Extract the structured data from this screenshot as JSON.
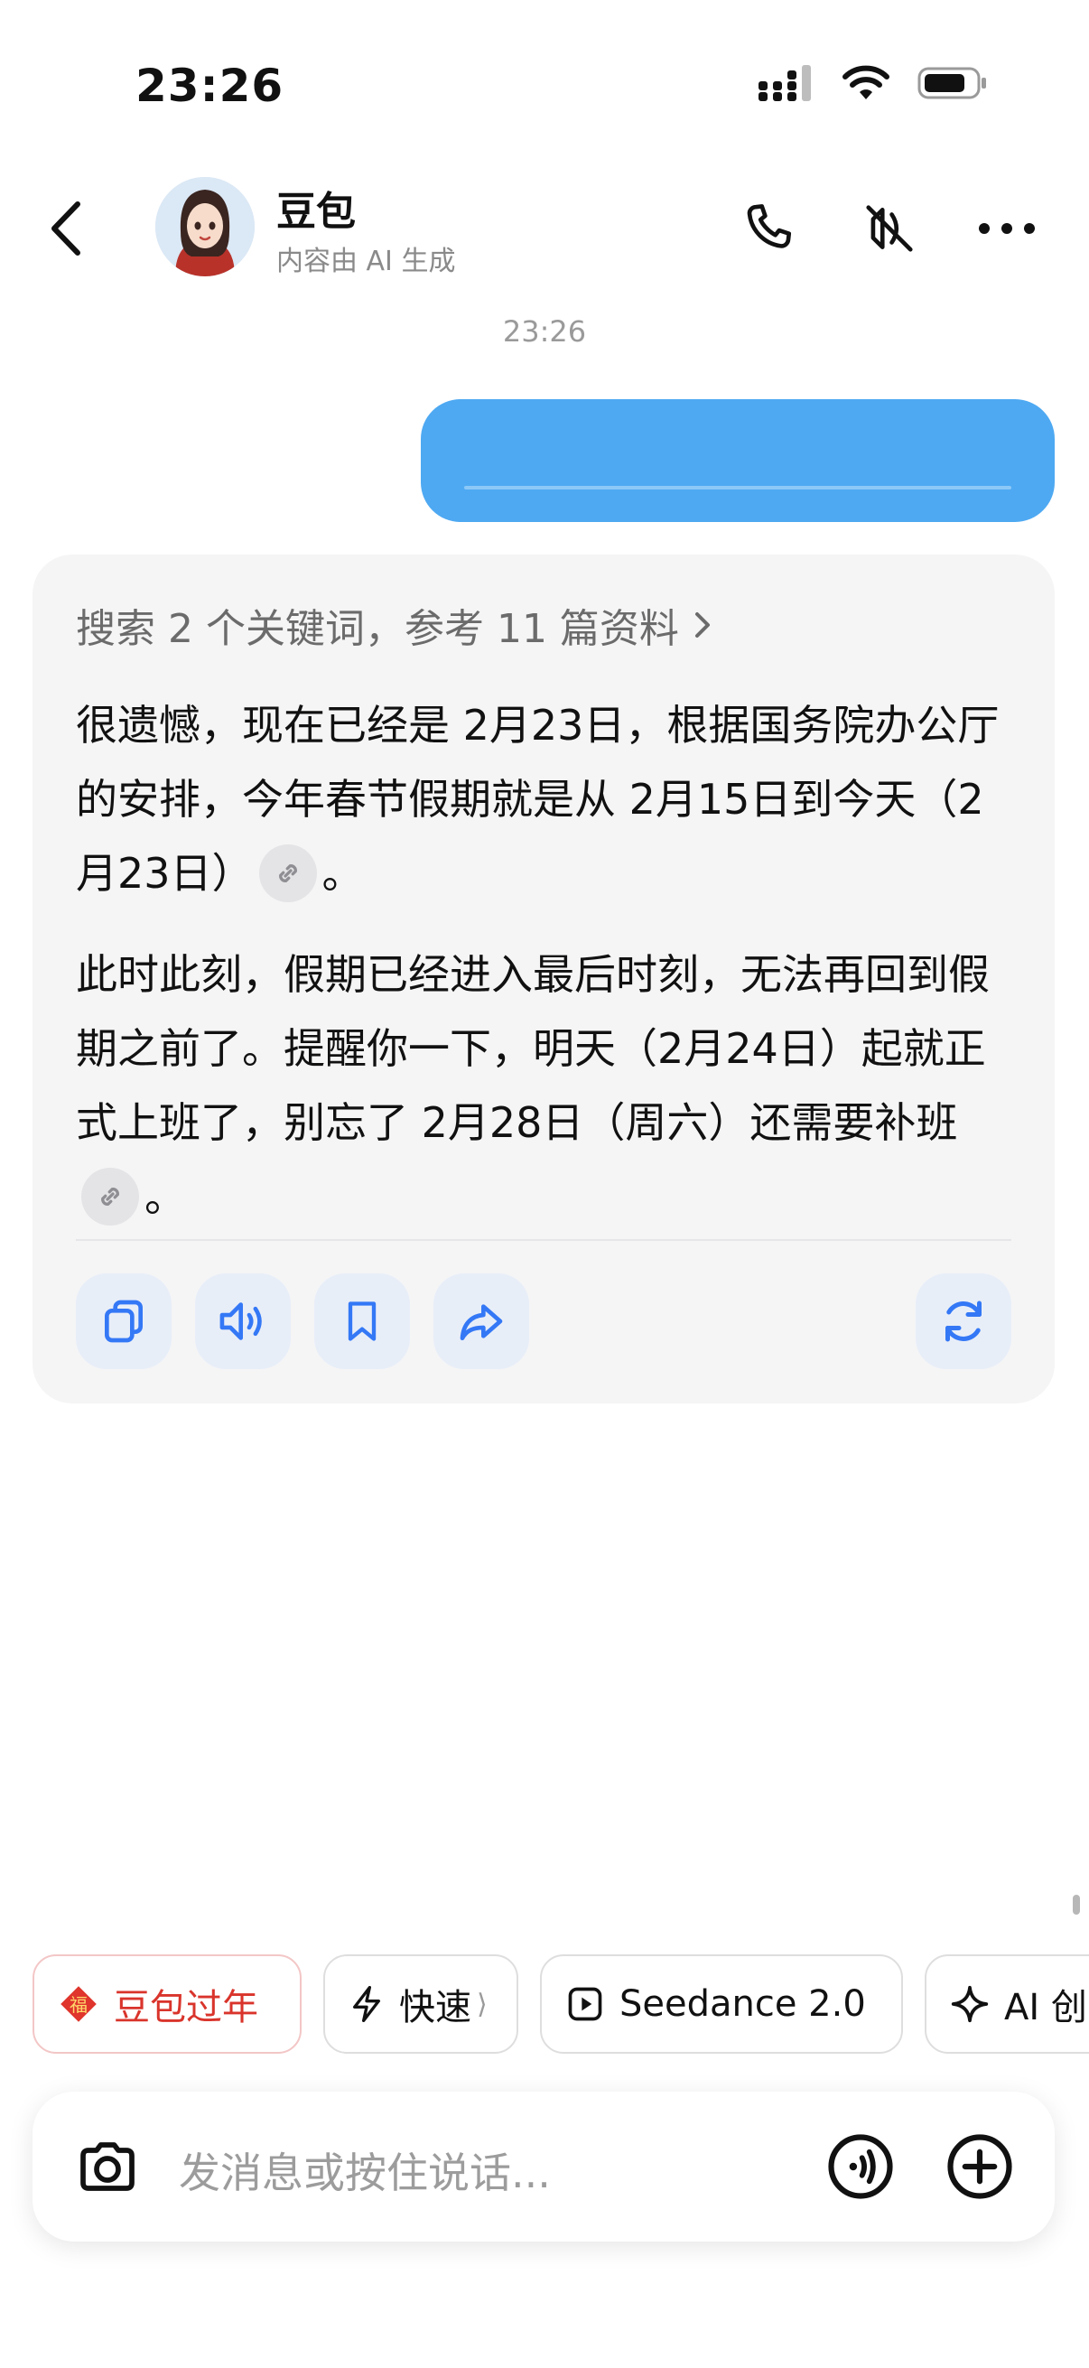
{
  "status_bar": {
    "time": "23:26"
  },
  "header": {
    "bot_name": "豆包",
    "bot_subtitle": "内容由 AI 生成",
    "icons": [
      "back-icon",
      "phone-icon",
      "mute-speaker-icon",
      "more-icon"
    ]
  },
  "chat": {
    "timestamp": "23:26",
    "user_bubble": {
      "type": "voice",
      "color": "#4ea9f2"
    },
    "bot_message": {
      "search_summary": "搜索 2 个关键词，参考 11 篇资料",
      "paragraph1": {
        "text": "很遗憾，现在已经是 2月23日，根据国务院办公厅的安排，今年春节假期就是从 2月15日到今天（2月23日）",
        "end": "。"
      },
      "paragraph2": {
        "text": "此时此刻，假期已经进入最后时刻，无法再回到假期之前了。提醒你一下，明天（2月24日）起就正式上班了，别忘了 2月28日（周六）还需要补班",
        "end": "。"
      },
      "actions": [
        "copy-icon",
        "speaker-icon",
        "bookmark-icon",
        "share-icon",
        "regenerate-icon"
      ]
    }
  },
  "chips": [
    {
      "label": "豆包过年",
      "icon": "fu-icon",
      "color": "#d9342b"
    },
    {
      "label": "快速",
      "icon": "lightning-icon",
      "suffix": "⟩"
    },
    {
      "label": "Seedance 2.0",
      "icon": "play-icon"
    },
    {
      "label": "AI 创",
      "icon": "sparkle-icon"
    }
  ],
  "input": {
    "placeholder": "发消息或按住说话..."
  },
  "colors": {
    "accent": "#3478f6",
    "user_bubble": "#4ea9f2",
    "card_bg": "#f5f5f6"
  }
}
